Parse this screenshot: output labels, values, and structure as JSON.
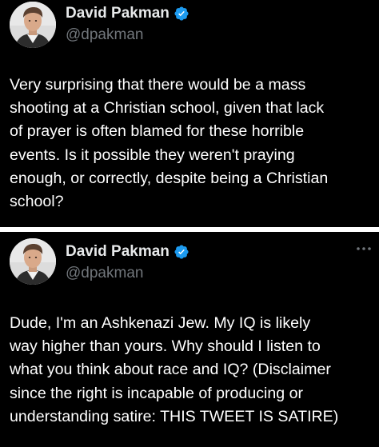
{
  "tweets": [
    {
      "author": {
        "display_name": "David Pakman",
        "handle": "@dpakman",
        "verified": true
      },
      "body": "Very surprising that there would be a mass\nshooting at a Christian school, given that lack\nof prayer is often blamed for these horrible\nevents. Is it possible they weren't praying\nenough, or correctly, despite being a Christian\nschool?"
    },
    {
      "author": {
        "display_name": "David Pakman",
        "handle": "@dpakman",
        "verified": true
      },
      "body": "Dude, I'm an Ashkenazi Jew. My IQ is likely\nway higher than yours. Why should I listen to\nwhat you think about race and IQ? (Disclaimer\nsince the right is incapable of producing or\nunderstanding satire: THIS TWEET IS SATIRE)"
    }
  ],
  "colors": {
    "background": "#000000",
    "text_primary": "#e7e9ea",
    "text_secondary": "#71767b",
    "verified_blue": "#1d9bf0",
    "divider": "#ffffff"
  },
  "icons": {
    "verified": "verified-badge-icon",
    "more": "more-options-icon",
    "avatar": "profile-avatar"
  }
}
